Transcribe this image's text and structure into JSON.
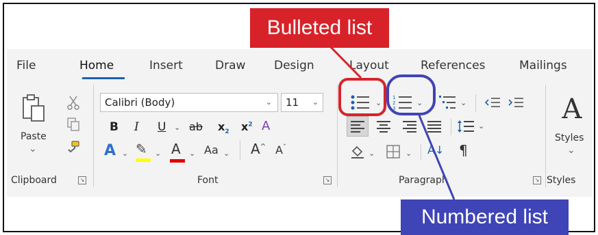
{
  "tabs": [
    "File",
    "Home",
    "Insert",
    "Draw",
    "Design",
    "Layout",
    "References",
    "Mailings"
  ],
  "active_tab": "Home",
  "clipboard": {
    "paste_label": "Paste",
    "paste_arrow": "⌄",
    "group_label": "Clipboard",
    "icons": [
      "paste-icon",
      "cut-icon",
      "copy-icon",
      "format-painter-icon"
    ]
  },
  "font": {
    "font_name": "Calibri (Body)",
    "font_size": "11",
    "bold": "B",
    "italic": "I",
    "underline": "U",
    "strikethrough": "ab",
    "subscript": "x",
    "subscript_mark": "2",
    "superscript": "x",
    "superscript_mark": "2",
    "clear_format": "A",
    "text_effects": "A",
    "highlight": "✎",
    "font_color": "A",
    "change_case": "Aa",
    "grow": "A",
    "shrink": "A",
    "group_label": "Font"
  },
  "paragraph": {
    "sort": "A↓",
    "pilcrow": "¶",
    "group_label": "Paragraph",
    "icons": [
      "bullets-icon",
      "numbering-icon",
      "multilevel-list-icon",
      "decrease-indent-icon",
      "increase-indent-icon",
      "align-left-icon",
      "center-icon",
      "align-right-icon",
      "justify-icon",
      "line-spacing-icon",
      "shading-icon",
      "borders-icon",
      "sort-icon",
      "show-formatting-icon"
    ]
  },
  "styles": {
    "glyph": "A",
    "label": "Styles",
    "arrow": "⌄",
    "group_label": "Styles"
  },
  "callouts": {
    "bulleted": "Bulleted list",
    "numbered": "Numbered list"
  },
  "colors": {
    "red_callout": "#d8222a",
    "blue_callout": "#3f44b6",
    "accent_blue": "#1b5fb4",
    "highlight_yellow": "#ffff00",
    "font_red": "#e00000"
  }
}
